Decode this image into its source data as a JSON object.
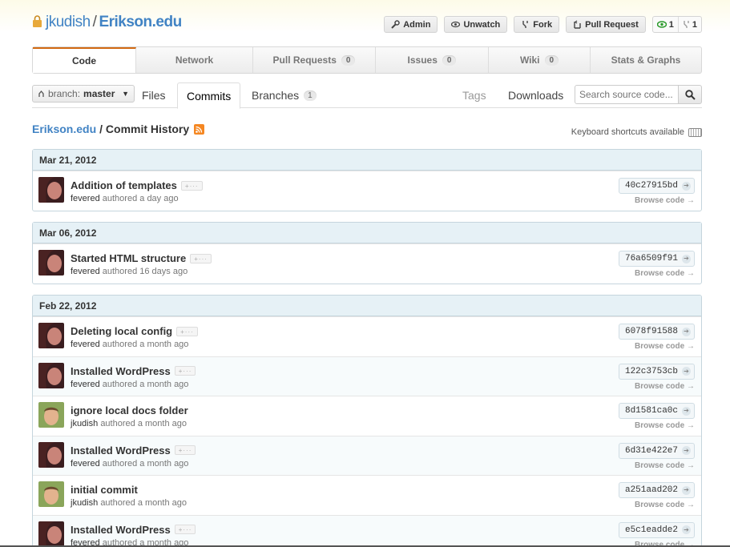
{
  "repo": {
    "owner": "jkudish",
    "separator": "/",
    "name": "Erikson.edu"
  },
  "actions": [
    {
      "label": "Admin",
      "icon": "wrench-icon"
    },
    {
      "label": "Unwatch",
      "icon": "eye-icon"
    },
    {
      "label": "Fork",
      "icon": "fork-icon"
    },
    {
      "label": "Pull Request",
      "icon": "pull-request-icon"
    }
  ],
  "counters": {
    "watchers": "1",
    "forks": "1"
  },
  "tabs": [
    {
      "label": "Code",
      "count": ""
    },
    {
      "label": "Network",
      "count": ""
    },
    {
      "label": "Pull Requests",
      "count": "0"
    },
    {
      "label": "Issues",
      "count": "0"
    },
    {
      "label": "Wiki",
      "count": "0"
    },
    {
      "label": "Stats & Graphs",
      "count": ""
    }
  ],
  "branch": {
    "prefix": "branch:",
    "value": "master"
  },
  "subnav": {
    "files": "Files",
    "commits": "Commits",
    "branches": "Branches",
    "branches_count": "1",
    "tags": "Tags",
    "downloads": "Downloads",
    "search_placeholder": "Search source code..."
  },
  "history": {
    "repo_link": "Erikson.edu",
    "title": "/ Commit History",
    "kbd_note": "Keyboard shortcuts available"
  },
  "browse_label": "Browse code",
  "groups": [
    {
      "date": "Mar 21, 2012",
      "commits": [
        {
          "message": "Addition of templates",
          "author": "fevered",
          "authored": "authored",
          "when": "a day ago",
          "sha": "40c27915bd",
          "avatar": "woman"
        }
      ]
    },
    {
      "date": "Mar 06, 2012",
      "commits": [
        {
          "message": "Started HTML structure",
          "author": "fevered",
          "authored": "authored",
          "when": "16 days ago",
          "sha": "76a6509f91",
          "avatar": "woman"
        }
      ]
    },
    {
      "date": "Feb 22, 2012",
      "commits": [
        {
          "message": "Deleting local config",
          "author": "fevered",
          "authored": "authored",
          "when": "a month ago",
          "sha": "6078f91588",
          "avatar": "woman"
        },
        {
          "message": "Installed WordPress",
          "author": "fevered",
          "authored": "authored",
          "when": "a month ago",
          "sha": "122c3753cb",
          "avatar": "woman"
        },
        {
          "message": "ignore local docs folder",
          "author": "jkudish",
          "authored": "authored",
          "when": "a month ago",
          "sha": "8d1581ca0c",
          "avatar": "man"
        },
        {
          "message": "Installed WordPress",
          "author": "fevered",
          "authored": "authored",
          "when": "a month ago",
          "sha": "6d31e422e7",
          "avatar": "woman"
        },
        {
          "message": "initial commit",
          "author": "jkudish",
          "authored": "authored",
          "when": "a month ago",
          "sha": "a251aad202",
          "avatar": "man"
        },
        {
          "message": "Installed WordPress",
          "author": "fevered",
          "authored": "authored",
          "when": "a month ago",
          "sha": "e5c1eadde2",
          "avatar": "woman"
        }
      ]
    }
  ]
}
